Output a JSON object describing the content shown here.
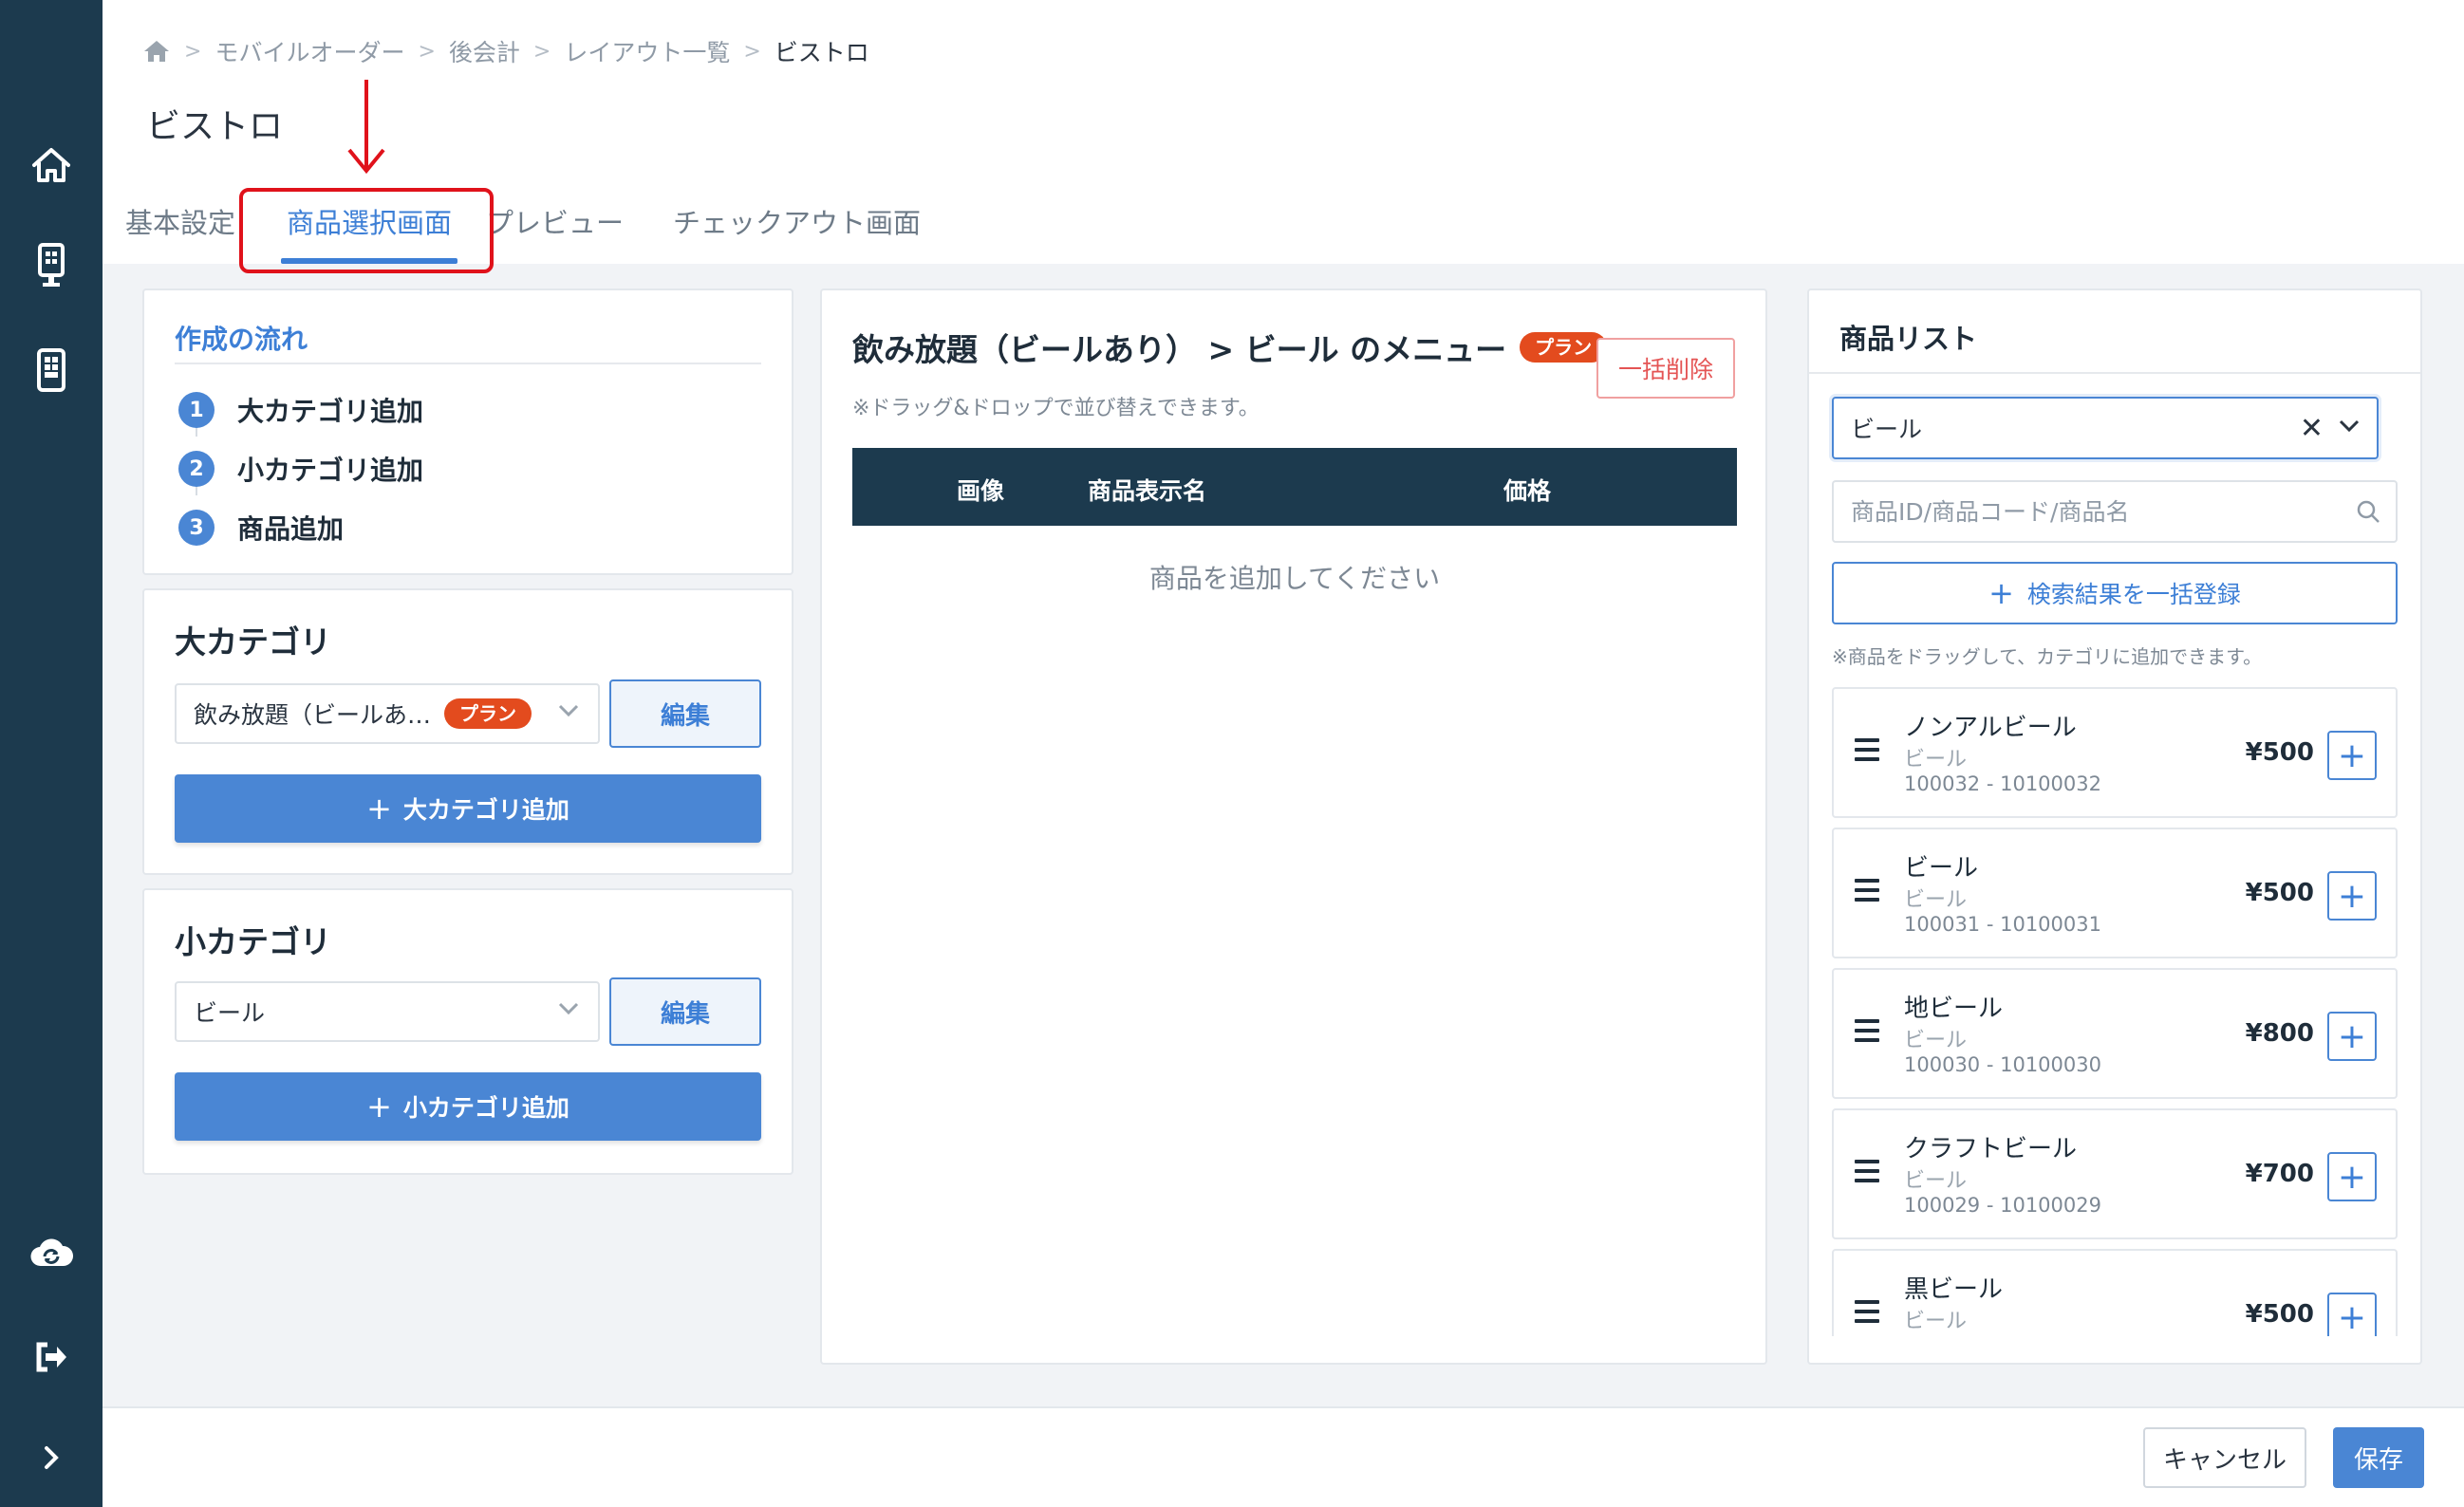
{
  "breadcrumb": [
    "モバイルオーダー",
    "後会計",
    "レイアウト一覧",
    "ビストロ"
  ],
  "page_title": "ビストロ",
  "tabs": [
    {
      "label": "基本設定"
    },
    {
      "label": "商品選択画面"
    },
    {
      "label": "プレビュー"
    },
    {
      "label": "チェックアウト画面"
    }
  ],
  "active_tab": "商品選択画面",
  "flow": {
    "title": "作成の流れ",
    "steps": [
      {
        "num": "1",
        "label": "大カテゴリ追加"
      },
      {
        "num": "2",
        "label": "小カテゴリ追加"
      },
      {
        "num": "3",
        "label": "商品追加"
      }
    ]
  },
  "major_category": {
    "title": "大カテゴリ",
    "selected": "飲み放題（ビールあ…",
    "badge": "プラン",
    "edit_label": "編集",
    "add_label": "大カテゴリ追加"
  },
  "minor_category": {
    "title": "小カテゴリ",
    "selected": "ビール",
    "edit_label": "編集",
    "add_label": "小カテゴリ追加"
  },
  "menu": {
    "title": "飲み放題（ビールあり） > ビール のメニュー",
    "badge": "プラン",
    "bulk_delete_label": "一括削除",
    "note": "※ドラッグ&ドロップで並び替えできます。",
    "columns": [
      "画像",
      "商品表示名",
      "価格"
    ],
    "empty_message": "商品を追加してください"
  },
  "product_list": {
    "title": "商品リスト",
    "filter_value": "ビール",
    "search_placeholder": "商品ID/商品コード/商品名",
    "bulk_register_label": "検索結果を一括登録",
    "note": "※商品をドラッグして、カテゴリに追加できます。",
    "items": [
      {
        "name": "ノンアルビール",
        "category": "ビール",
        "code": "100032 - 10100032",
        "price": "¥500"
      },
      {
        "name": "ビール",
        "category": "ビール",
        "code": "100031 - 10100031",
        "price": "¥500"
      },
      {
        "name": "地ビール",
        "category": "ビール",
        "code": "100030 - 10100030",
        "price": "¥800"
      },
      {
        "name": "クラフトビール",
        "category": "ビール",
        "code": "100029 - 10100029",
        "price": "¥700"
      },
      {
        "name": "黒ビール",
        "category": "ビール",
        "code": "",
        "price": "¥500"
      }
    ]
  },
  "footer": {
    "cancel_label": "キャンセル",
    "save_label": "保存"
  },
  "colors": {
    "sidebar": "#1c3a4e",
    "accent": "#4a86d4",
    "badge": "#e34b1e",
    "annotation": "#e0121b"
  },
  "icons": {
    "sidebar": [
      "home-icon",
      "kiosk-icon",
      "tablet-icon",
      "cloud-sync-icon",
      "logout-icon",
      "chevron-right-icon"
    ]
  }
}
